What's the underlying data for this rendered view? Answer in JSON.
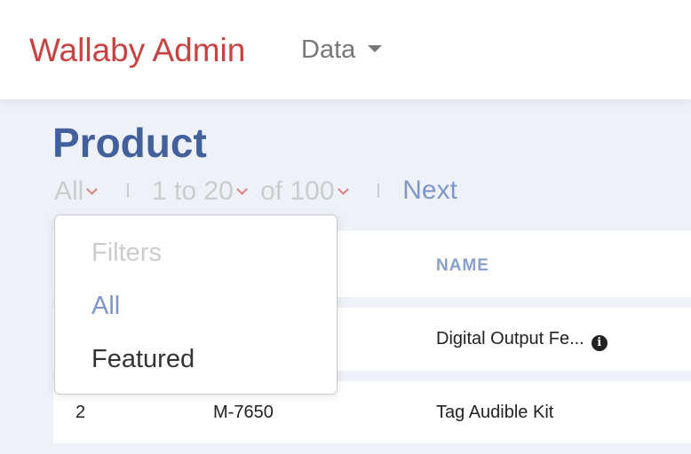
{
  "navbar": {
    "brand": "Wallaby Admin",
    "menu": "Data"
  },
  "page": {
    "title": "Product"
  },
  "pager": {
    "filter": "All",
    "range": "1 to 20",
    "total": "of 100",
    "next": "Next"
  },
  "table": {
    "columns": [
      "",
      "",
      "NAME"
    ],
    "rows": [
      [
        "",
        "",
        "Digital Output Fe..."
      ],
      [
        "2",
        "M-7650",
        "Tag Audible Kit"
      ]
    ]
  },
  "dropdown": {
    "header": "Filters",
    "items": [
      "All",
      "Featured"
    ]
  },
  "colors": {
    "brand": "#c94242",
    "accent": "#41609c",
    "link": "#7f97c8"
  }
}
